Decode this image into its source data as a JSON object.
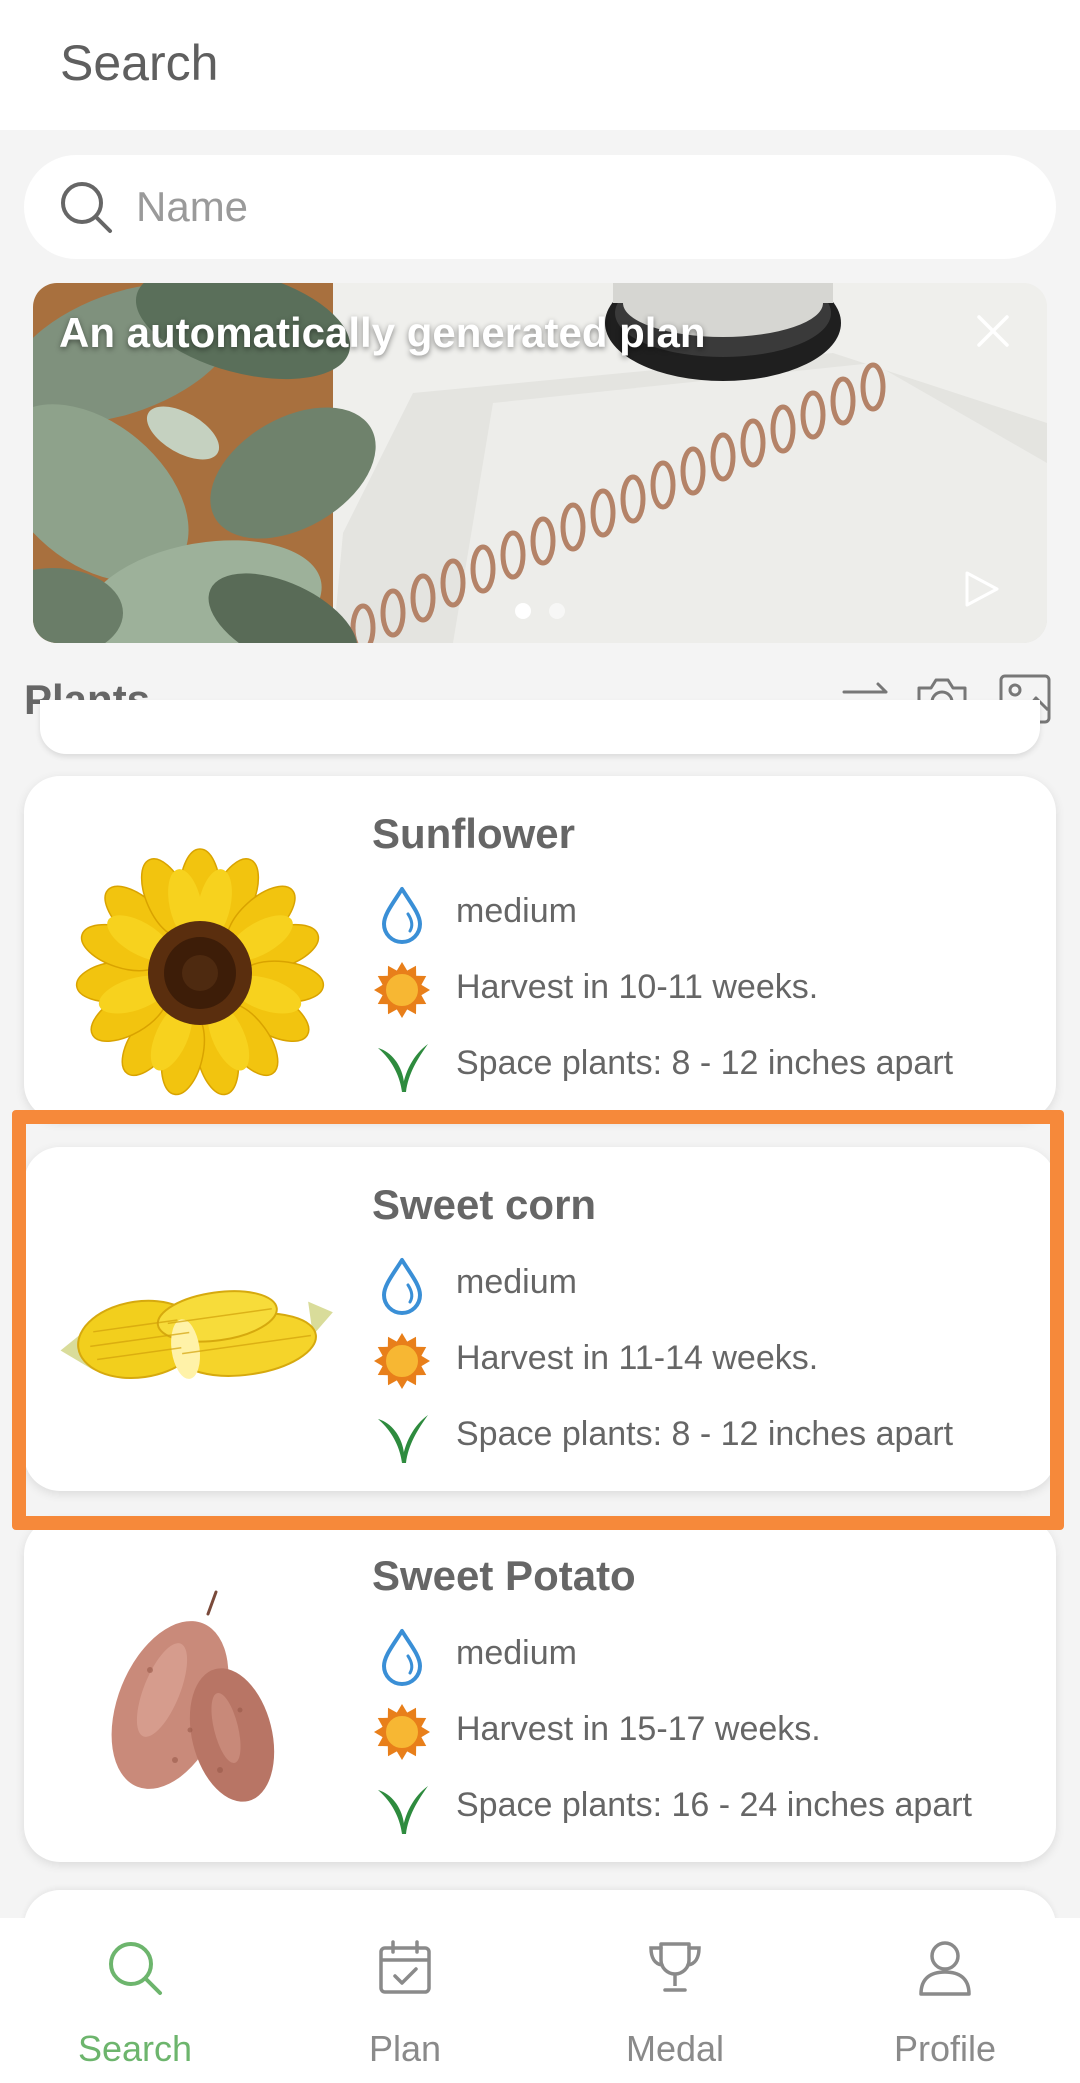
{
  "header": {
    "title": "Search"
  },
  "search": {
    "placeholder": "Name",
    "value": ""
  },
  "banner": {
    "title": "An automatically generated plan",
    "dots": 2,
    "active_dot": 1
  },
  "plants_section": {
    "title": "Plants",
    "tools": [
      "sort-icon",
      "camera-icon",
      "gallery-icon"
    ]
  },
  "plants": [
    {
      "name": "Sunflower",
      "water": "medium",
      "harvest": "Harvest in 10-11 weeks.",
      "spacing": "Space plants: 8 - 12 inches apart"
    },
    {
      "name": "Sweet corn",
      "water": "medium",
      "harvest": "Harvest in 11-14 weeks.",
      "spacing": "Space plants: 8 - 12 inches apart",
      "highlighted": true
    },
    {
      "name": "Sweet Potato",
      "water": "medium",
      "harvest": "Harvest in 15-17 weeks.",
      "spacing": "Space plants: 16 - 24 inches apart"
    }
  ],
  "nav": {
    "items": [
      {
        "label": "Search",
        "icon": "search-icon",
        "active": true
      },
      {
        "label": "Plan",
        "icon": "calendar-icon",
        "active": false
      },
      {
        "label": "Medal",
        "icon": "trophy-icon",
        "active": false
      },
      {
        "label": "Profile",
        "icon": "person-icon",
        "active": false
      }
    ]
  },
  "colors": {
    "accent": "#6db56d",
    "highlight": "#f6893a",
    "water": "#3a8fd6",
    "sun": "#e87f1a",
    "sprout": "#2e8b3e"
  }
}
